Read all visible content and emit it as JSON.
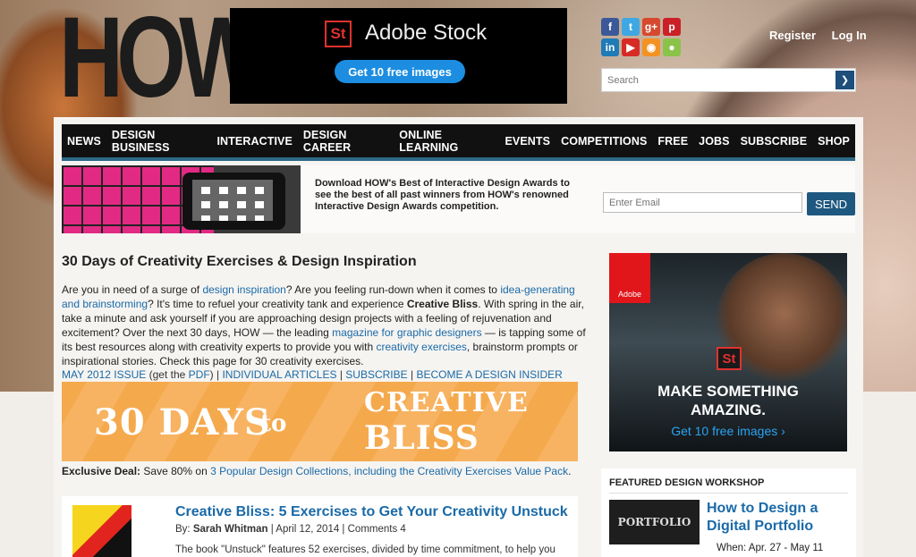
{
  "site": {
    "logo": "HOW"
  },
  "top_ad": {
    "logo_mark": "St",
    "brand": "Adobe Stock",
    "cta": "Get 10 free images"
  },
  "social_icons": [
    {
      "name": "facebook",
      "glyph": "f",
      "color": "#3b5998"
    },
    {
      "name": "twitter",
      "glyph": "t",
      "color": "#3fa8e3"
    },
    {
      "name": "google-plus",
      "glyph": "g+",
      "color": "#d6492f"
    },
    {
      "name": "pinterest",
      "glyph": "p",
      "color": "#cb2027"
    },
    {
      "name": "linkedin",
      "glyph": "in",
      "color": "#1f7bb6"
    },
    {
      "name": "youtube",
      "glyph": "▶",
      "color": "#d72b26"
    },
    {
      "name": "rss",
      "glyph": "◉",
      "color": "#f39223"
    },
    {
      "name": "flickr",
      "glyph": "●",
      "color": "#8bc34a"
    }
  ],
  "header_links": {
    "register": "Register",
    "login": "Log In"
  },
  "search": {
    "placeholder": "Search"
  },
  "nav": [
    "NEWS",
    "DESIGN BUSINESS",
    "INTERACTIVE",
    "DESIGN CAREER",
    "ONLINE LEARNING",
    "EVENTS",
    "COMPETITIONS",
    "FREE",
    "JOBS",
    "SUBSCRIBE",
    "SHOP"
  ],
  "promo": {
    "text": "Download HOW's Best of Interactive Design Awards to see the best of all past winners from HOW's renowned Interactive Design Awards competition.",
    "email_placeholder": "Enter Email",
    "send": "SEND"
  },
  "main": {
    "title": "30 Days of Creativity Exercises & Design Inspiration",
    "intro": {
      "p1": "Are you in need of a surge of ",
      "l1": "design inspiration",
      "p2": "? Are you feeling run-down when it comes to ",
      "l2": "idea-generating and brainstorming",
      "p3": "? It's time to refuel your creativity tank and experience ",
      "b1": "Creative Bliss",
      "p4": ". With spring in the air, take a minute and ask yourself if you are approaching design projects with a feeling of rejuvenation and excitement? Over the next 30 days, HOW — the leading ",
      "l3": "magazine for graphic designers",
      "p5": " — is tapping some of its best resources along with creativity experts to provide you with ",
      "l4": "creativity exercises",
      "p6": ", brainstorm prompts or inspirational stories. Check this page for 30 creativity exercises."
    },
    "links": {
      "issue": "MAY 2012 ISSUE",
      "get_the": " (get the ",
      "pdf": "PDF",
      "close": ")",
      "sep": " | ",
      "articles": "INDIVIDUAL ARTICLES",
      "subscribe": "SUBSCRIBE",
      "insider": "BECOME A DESIGN INSIDER"
    },
    "banner": {
      "l1": "30 DAYS",
      "l2": "to",
      "l3": "CREATIVE",
      "l4": "BLISS"
    },
    "deal": {
      "label": "Exclusive Deal:",
      "text": " Save 80% on ",
      "link": "3 Popular Design Collections, including the Creativity Exercises Value Pack",
      "end": "."
    },
    "article": {
      "title": "Creative Bliss: 5 Exercises to Get Your Creativity Unstuck",
      "by": "By: ",
      "author": "Sarah Whitman",
      "meta": " | April 12, 2014 | Comments 4",
      "excerpt": "The book \"Unstuck\" features 52 exercises, divided by time commitment, to help you"
    }
  },
  "side_ad": {
    "adobe": "Adobe",
    "mark": "St",
    "line1": "MAKE SOMETHING",
    "line2": "AMAZING.",
    "cta": "Get 10 free images ›"
  },
  "workshop": {
    "header": "FEATURED DESIGN WORKSHOP",
    "image_text": "PORTFOLIO",
    "title1": "How to Design a",
    "title2": "Digital Portfolio",
    "when": "When: Apr. 27 - May 11"
  }
}
